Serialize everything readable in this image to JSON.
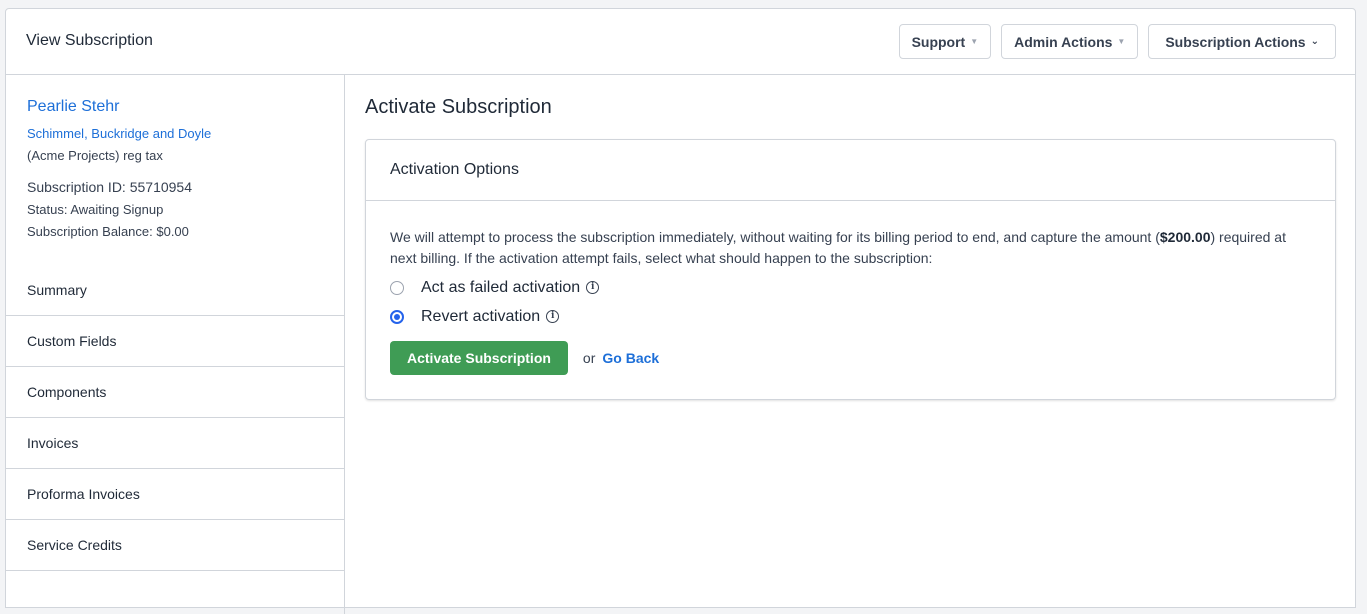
{
  "header": {
    "title": "View Subscription",
    "support_label": "Support",
    "admin_actions_label": "Admin Actions",
    "subscription_actions_label": "Subscription Actions"
  },
  "customer": {
    "name": "Pearlie Stehr",
    "company": "Schimmel, Buckridge and Doyle",
    "plan": "(Acme Projects) reg tax",
    "subscription_id": "Subscription ID: 55710954",
    "status": "Status: Awaiting Signup",
    "balance": "Subscription Balance: $0.00"
  },
  "nav": {
    "items": [
      {
        "label": "Summary"
      },
      {
        "label": "Custom Fields"
      },
      {
        "label": "Components"
      },
      {
        "label": "Invoices"
      },
      {
        "label": "Proforma Invoices"
      },
      {
        "label": "Service Credits"
      }
    ]
  },
  "main": {
    "title": "Activate Subscription",
    "panel_title": "Activation Options",
    "desc_before": "We will attempt to process the subscription immediately, without waiting for its billing period to end, and capture the amount (",
    "amount": "$200.00",
    "desc_after": ") required at next billing. If the activation attempt fails, select what should happen to the subscription:",
    "options": [
      {
        "label": "Act as failed activation",
        "selected": false
      },
      {
        "label": "Revert activation",
        "selected": true
      }
    ],
    "activate_label": "Activate Subscription",
    "or_text": "or",
    "back_label": "Go Back"
  },
  "colors": {
    "link": "#1d6fd8",
    "primary_button": "#3f9c55",
    "radio_selected": "#2563eb"
  }
}
